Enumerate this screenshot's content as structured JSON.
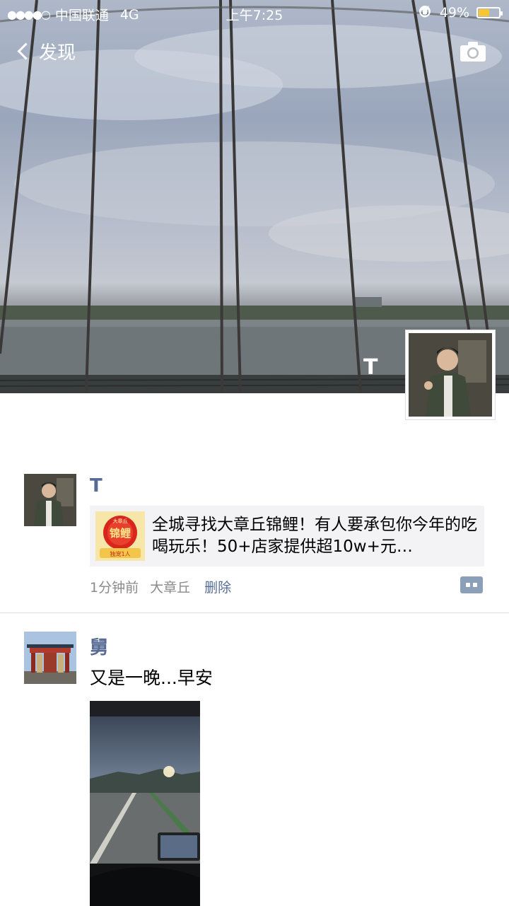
{
  "status_bar": {
    "signal": "●●●●○",
    "carrier": "中国联通",
    "network": "4G",
    "time": "上午7:25",
    "battery_percent": "49%",
    "battery_level": 0.49
  },
  "nav": {
    "back_label": "发现"
  },
  "profile": {
    "name": "T"
  },
  "posts": [
    {
      "name": "T",
      "link_title": "全城寻找大章丘锦鲤！有人要承包你今年的吃喝玩乐！50+店家提供超10w+元…",
      "link_thumb_text_top": "大章丘",
      "link_thumb_text_main": "锦鲤",
      "link_thumb_text_bottom": "独宠1人",
      "time": "1分钟前",
      "location": "大章丘",
      "delete_label": "删除"
    },
    {
      "name": "舅",
      "text": "又是一晚...早安"
    }
  ],
  "colors": {
    "name_link": "#576b95",
    "meta_gray": "#8a8a8a",
    "card_bg": "#f3f3f5",
    "battery": "#f7c632"
  }
}
